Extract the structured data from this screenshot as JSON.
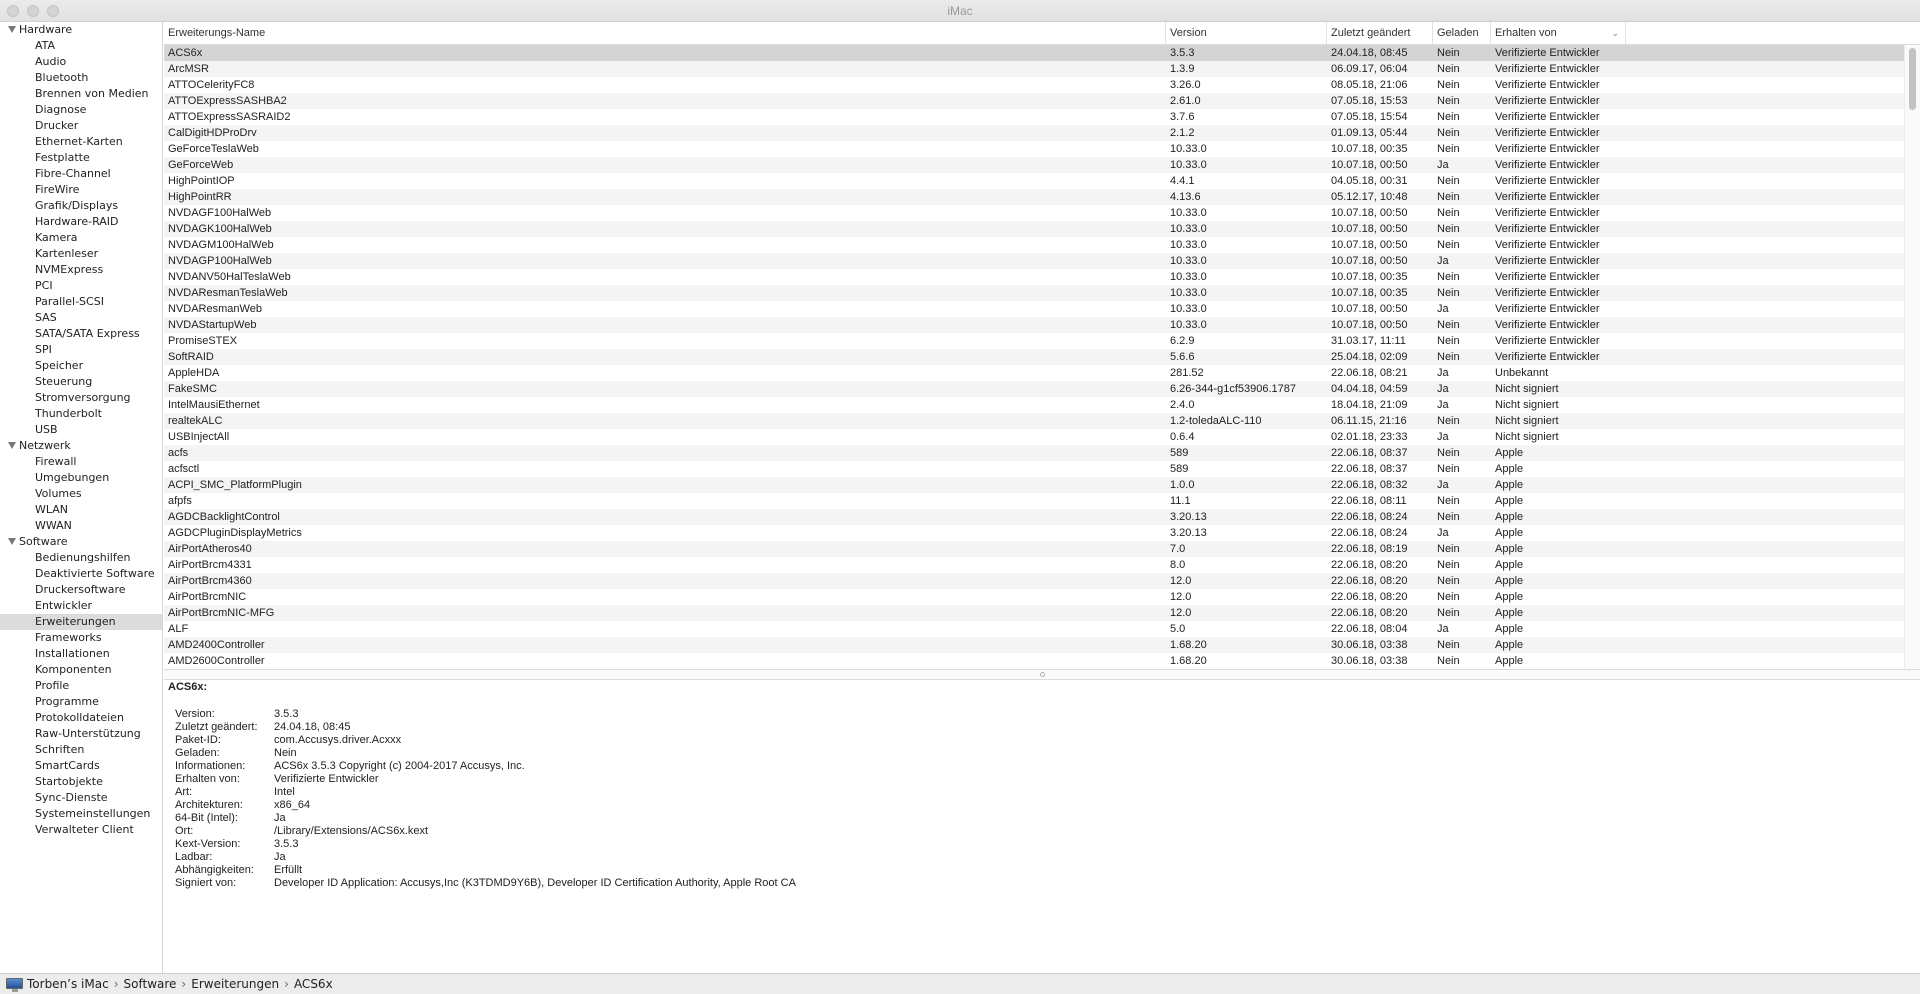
{
  "window": {
    "title": "iMac"
  },
  "sidebar": [
    {
      "label": "Hardware",
      "group": true
    },
    {
      "label": "ATA"
    },
    {
      "label": "Audio"
    },
    {
      "label": "Bluetooth"
    },
    {
      "label": "Brennen von Medien"
    },
    {
      "label": "Diagnose"
    },
    {
      "label": "Drucker"
    },
    {
      "label": "Ethernet-Karten"
    },
    {
      "label": "Festplatte"
    },
    {
      "label": "Fibre-Channel"
    },
    {
      "label": "FireWire"
    },
    {
      "label": "Grafik/Displays"
    },
    {
      "label": "Hardware-RAID"
    },
    {
      "label": "Kamera"
    },
    {
      "label": "Kartenleser"
    },
    {
      "label": "NVMExpress"
    },
    {
      "label": "PCI"
    },
    {
      "label": "Parallel-SCSI"
    },
    {
      "label": "SAS"
    },
    {
      "label": "SATA/SATA Express"
    },
    {
      "label": "SPI"
    },
    {
      "label": "Speicher"
    },
    {
      "label": "Steuerung"
    },
    {
      "label": "Stromversorgung"
    },
    {
      "label": "Thunderbolt"
    },
    {
      "label": "USB"
    },
    {
      "label": "Netzwerk",
      "group": true
    },
    {
      "label": "Firewall"
    },
    {
      "label": "Umgebungen"
    },
    {
      "label": "Volumes"
    },
    {
      "label": "WLAN"
    },
    {
      "label": "WWAN"
    },
    {
      "label": "Software",
      "group": true
    },
    {
      "label": "Bedienungshilfen"
    },
    {
      "label": "Deaktivierte Software"
    },
    {
      "label": "Druckersoftware"
    },
    {
      "label": "Entwickler"
    },
    {
      "label": "Erweiterungen",
      "selected": true
    },
    {
      "label": "Frameworks"
    },
    {
      "label": "Installationen"
    },
    {
      "label": "Komponenten"
    },
    {
      "label": "Profile"
    },
    {
      "label": "Programme"
    },
    {
      "label": "Protokolldateien"
    },
    {
      "label": "Raw-Unterstützung"
    },
    {
      "label": "Schriften"
    },
    {
      "label": "SmartCards"
    },
    {
      "label": "Startobjekte"
    },
    {
      "label": "Sync-Dienste"
    },
    {
      "label": "Systemeinstellungen"
    },
    {
      "label": "Verwalteter Client"
    }
  ],
  "table": {
    "columns": [
      "Erweiterungs-Name",
      "Version",
      "Zuletzt geändert",
      "Geladen",
      "Erhalten von"
    ],
    "sort_icon": "chevron-down-icon",
    "selected_row": 0,
    "rows": [
      [
        "ACS6x",
        "3.5.3",
        "24.04.18, 08:45",
        "Nein",
        "Verifizierte Entwickler"
      ],
      [
        "ArcMSR",
        "1.3.9",
        "06.09.17, 06:04",
        "Nein",
        "Verifizierte Entwickler"
      ],
      [
        "ATTOCelerityFC8",
        "3.26.0",
        "08.05.18, 21:06",
        "Nein",
        "Verifizierte Entwickler"
      ],
      [
        "ATTOExpressSASHBA2",
        "2.61.0",
        "07.05.18, 15:53",
        "Nein",
        "Verifizierte Entwickler"
      ],
      [
        "ATTOExpressSASRAID2",
        "3.7.6",
        "07.05.18, 15:54",
        "Nein",
        "Verifizierte Entwickler"
      ],
      [
        "CalDigitHDProDrv",
        "2.1.2",
        "01.09.13, 05:44",
        "Nein",
        "Verifizierte Entwickler"
      ],
      [
        "GeForceTeslaWeb",
        "10.33.0",
        "10.07.18, 00:35",
        "Nein",
        "Verifizierte Entwickler"
      ],
      [
        "GeForceWeb",
        "10.33.0",
        "10.07.18, 00:50",
        "Ja",
        "Verifizierte Entwickler"
      ],
      [
        "HighPointIOP",
        "4.4.1",
        "04.05.18, 00:31",
        "Nein",
        "Verifizierte Entwickler"
      ],
      [
        "HighPointRR",
        "4.13.6",
        "05.12.17, 10:48",
        "Nein",
        "Verifizierte Entwickler"
      ],
      [
        "NVDAGF100HalWeb",
        "10.33.0",
        "10.07.18, 00:50",
        "Nein",
        "Verifizierte Entwickler"
      ],
      [
        "NVDAGK100HalWeb",
        "10.33.0",
        "10.07.18, 00:50",
        "Nein",
        "Verifizierte Entwickler"
      ],
      [
        "NVDAGM100HalWeb",
        "10.33.0",
        "10.07.18, 00:50",
        "Nein",
        "Verifizierte Entwickler"
      ],
      [
        "NVDAGP100HalWeb",
        "10.33.0",
        "10.07.18, 00:50",
        "Ja",
        "Verifizierte Entwickler"
      ],
      [
        "NVDANV50HalTeslaWeb",
        "10.33.0",
        "10.07.18, 00:35",
        "Nein",
        "Verifizierte Entwickler"
      ],
      [
        "NVDAResmanTeslaWeb",
        "10.33.0",
        "10.07.18, 00:35",
        "Nein",
        "Verifizierte Entwickler"
      ],
      [
        "NVDAResmanWeb",
        "10.33.0",
        "10.07.18, 00:50",
        "Ja",
        "Verifizierte Entwickler"
      ],
      [
        "NVDAStartupWeb",
        "10.33.0",
        "10.07.18, 00:50",
        "Nein",
        "Verifizierte Entwickler"
      ],
      [
        "PromiseSTEX",
        "6.2.9",
        "31.03.17, 11:11",
        "Nein",
        "Verifizierte Entwickler"
      ],
      [
        "SoftRAID",
        "5.6.6",
        "25.04.18, 02:09",
        "Nein",
        "Verifizierte Entwickler"
      ],
      [
        "AppleHDA",
        "281.52",
        "22.06.18, 08:21",
        "Ja",
        "Unbekannt"
      ],
      [
        "FakeSMC",
        "6.26-344-g1cf53906.1787",
        "04.04.18, 04:59",
        "Ja",
        "Nicht signiert"
      ],
      [
        "IntelMausiEthernet",
        "2.4.0",
        "18.04.18, 21:09",
        "Ja",
        "Nicht signiert"
      ],
      [
        "realtekALC",
        "1.2-toledaALC-110",
        "06.11.15, 21:16",
        "Nein",
        "Nicht signiert"
      ],
      [
        "USBInjectAll",
        "0.6.4",
        "02.01.18, 23:33",
        "Ja",
        "Nicht signiert"
      ],
      [
        "acfs",
        "589",
        "22.06.18, 08:37",
        "Nein",
        "Apple"
      ],
      [
        "acfsctl",
        "589",
        "22.06.18, 08:37",
        "Nein",
        "Apple"
      ],
      [
        "ACPI_SMC_PlatformPlugin",
        "1.0.0",
        "22.06.18, 08:32",
        "Ja",
        "Apple"
      ],
      [
        "afpfs",
        "11.1",
        "22.06.18, 08:11",
        "Nein",
        "Apple"
      ],
      [
        "AGDCBacklightControl",
        "3.20.13",
        "22.06.18, 08:24",
        "Nein",
        "Apple"
      ],
      [
        "AGDCPluginDisplayMetrics",
        "3.20.13",
        "22.06.18, 08:24",
        "Ja",
        "Apple"
      ],
      [
        "AirPortAtheros40",
        "7.0",
        "22.06.18, 08:19",
        "Nein",
        "Apple"
      ],
      [
        "AirPortBrcm4331",
        "8.0",
        "22.06.18, 08:20",
        "Nein",
        "Apple"
      ],
      [
        "AirPortBrcm4360",
        "12.0",
        "22.06.18, 08:20",
        "Nein",
        "Apple"
      ],
      [
        "AirPortBrcmNIC",
        "12.0",
        "22.06.18, 08:20",
        "Nein",
        "Apple"
      ],
      [
        "AirPortBrcmNIC-MFG",
        "12.0",
        "22.06.18, 08:20",
        "Nein",
        "Apple"
      ],
      [
        "ALF",
        "5.0",
        "22.06.18, 08:04",
        "Ja",
        "Apple"
      ],
      [
        "AMD2400Controller",
        "1.68.20",
        "30.06.18, 03:38",
        "Nein",
        "Apple"
      ],
      [
        "AMD2600Controller",
        "1.68.20",
        "30.06.18, 03:38",
        "Nein",
        "Apple"
      ]
    ]
  },
  "detail": {
    "title": "ACS6x:",
    "fields": [
      {
        "label": "Version:",
        "value": "3.5.3"
      },
      {
        "label": "Zuletzt geändert:",
        "value": "24.04.18, 08:45"
      },
      {
        "label": "Paket-ID:",
        "value": "com.Accusys.driver.Acxxx"
      },
      {
        "label": "Geladen:",
        "value": "Nein"
      },
      {
        "label": "Informationen:",
        "value": "ACS6x 3.5.3 Copyright (c) 2004-2017 Accusys, Inc."
      },
      {
        "label": "Erhalten von:",
        "value": "Verifizierte Entwickler"
      },
      {
        "label": "Art:",
        "value": "Intel"
      },
      {
        "label": "Architekturen:",
        "value": "x86_64"
      },
      {
        "label": "64-Bit (Intel):",
        "value": "Ja"
      },
      {
        "label": "Ort:",
        "value": "/Library/Extensions/ACS6x.kext"
      },
      {
        "label": "Kext-Version:",
        "value": "3.5.3"
      },
      {
        "label": "Ladbar:",
        "value": "Ja"
      },
      {
        "label": "Abhängigkeiten:",
        "value": "Erfüllt"
      },
      {
        "label": "Signiert von:",
        "value": "Developer ID Application: Accusys,Inc (K3TDMD9Y6B), Developer ID Certification Authority, Apple Root CA"
      }
    ]
  },
  "statusbar": {
    "crumbs": [
      "Torben’s iMac",
      "Software",
      "Erweiterungen",
      "ACS6x"
    ],
    "separator": "›"
  }
}
